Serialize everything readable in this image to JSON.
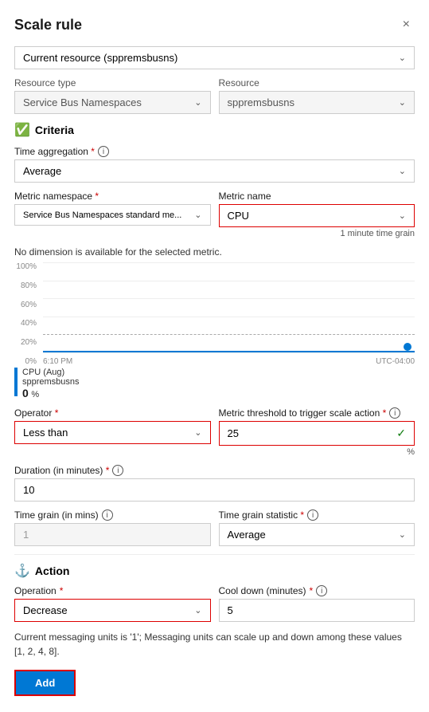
{
  "header": {
    "title": "Scale rule",
    "close_label": "×"
  },
  "resource_dropdown": {
    "value": "Current resource (sppremsbusns)",
    "label": "Current resource (sppremsbusns)"
  },
  "resource_type": {
    "label": "Resource type",
    "value": "Service Bus Namespaces"
  },
  "resource": {
    "label": "Resource",
    "value": "sppremsbusns"
  },
  "criteria": {
    "section_label": "Criteria"
  },
  "time_aggregation": {
    "label": "Time aggregation",
    "required": "*",
    "value": "Average"
  },
  "metric_namespace": {
    "label": "Metric namespace",
    "required": "*",
    "value": "Service Bus Namespaces standard me..."
  },
  "metric_name": {
    "label": "Metric name",
    "value": "CPU",
    "time_grain_note": "1 minute time grain"
  },
  "no_dimension": "No dimension is available for the selected metric.",
  "chart": {
    "y_labels": [
      "100%",
      "80%",
      "60%",
      "40%",
      "20%",
      "0%"
    ],
    "x_labels": [
      "6:10 PM",
      "UTC-04:00"
    ],
    "dashed_pct": 20,
    "legend_name": "CPU (Aug)",
    "legend_sub": "sppremsbusns",
    "legend_value": "0",
    "legend_unit": "%"
  },
  "operator": {
    "label": "Operator",
    "required": "*",
    "value": "Less than"
  },
  "metric_threshold": {
    "label": "Metric threshold to trigger scale action",
    "required": "*",
    "value": "25"
  },
  "percent_note": "%",
  "duration": {
    "label": "Duration (in minutes)",
    "required": "*",
    "value": "10"
  },
  "time_grain_mins": {
    "label": "Time grain (in mins)",
    "value": "1"
  },
  "time_grain_statistic": {
    "label": "Time grain statistic",
    "required": "*",
    "value": "Average"
  },
  "action": {
    "section_label": "Action"
  },
  "operation": {
    "label": "Operation",
    "required": "*",
    "value": "Decrease"
  },
  "cool_down": {
    "label": "Cool down (minutes)",
    "required": "*",
    "value": "5"
  },
  "note": "Current messaging units is '1'; Messaging units can scale up and down among these values [1, 2, 4, 8].",
  "add_button": "Add",
  "info_icon": "i"
}
